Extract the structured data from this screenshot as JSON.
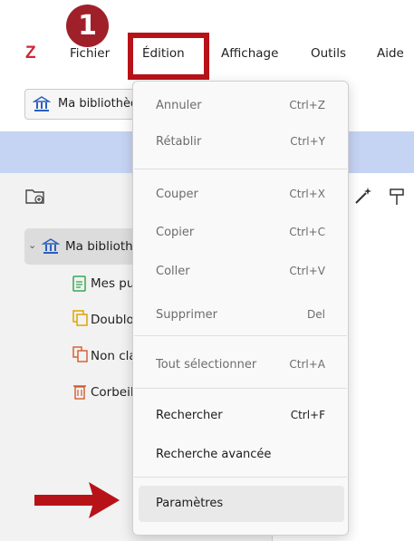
{
  "menubar": {
    "logo": "Z",
    "items": [
      "Fichier",
      "Édition",
      "Affichage",
      "Outils",
      "Aide"
    ]
  },
  "annotation": {
    "step_number": "1"
  },
  "toolbar": {
    "library_tab_label": "Ma bibliothèque"
  },
  "tree": {
    "root_label": "Ma bibliothèque",
    "children": [
      "Mes publications",
      "Doublons",
      "Non classés",
      "Corbeille"
    ]
  },
  "dropdown": {
    "items": [
      {
        "label": "Annuler",
        "shortcut": "Ctrl+Z",
        "enabled": false
      },
      {
        "label": "Rétablir",
        "shortcut": "Ctrl+Y",
        "enabled": false
      },
      {
        "label": "Couper",
        "shortcut": "Ctrl+X",
        "enabled": false
      },
      {
        "label": "Copier",
        "shortcut": "Ctrl+C",
        "enabled": false
      },
      {
        "label": "Coller",
        "shortcut": "Ctrl+V",
        "enabled": false
      },
      {
        "label": "Supprimer",
        "shortcut": "Del",
        "enabled": false
      },
      {
        "label": "Tout sélectionner",
        "shortcut": "Ctrl+A",
        "enabled": false
      },
      {
        "label": "Rechercher",
        "shortcut": "Ctrl+F",
        "enabled": true
      },
      {
        "label": "Recherche avancée",
        "shortcut": "",
        "enabled": true
      },
      {
        "label": "Paramètres",
        "shortcut": "",
        "enabled": true
      }
    ]
  },
  "colors": {
    "accent_red": "#b81219",
    "badge": "#a0202a",
    "blue_band": "#c6d4f4"
  }
}
